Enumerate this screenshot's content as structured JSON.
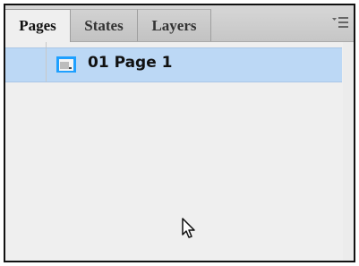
{
  "tabs": [
    {
      "label": "Pages",
      "active": true
    },
    {
      "label": "States",
      "active": false
    },
    {
      "label": "Layers",
      "active": false
    }
  ],
  "panel_menu": {
    "icon": "panel-menu-icon"
  },
  "pages": [
    {
      "label": "01 Page 1",
      "selected": true,
      "icon": "page-thumbnail-icon"
    }
  ],
  "colors": {
    "selection": "#bcd8f5",
    "thumbnail_border": "#1ea0ff",
    "panel_background": "#efefef"
  }
}
